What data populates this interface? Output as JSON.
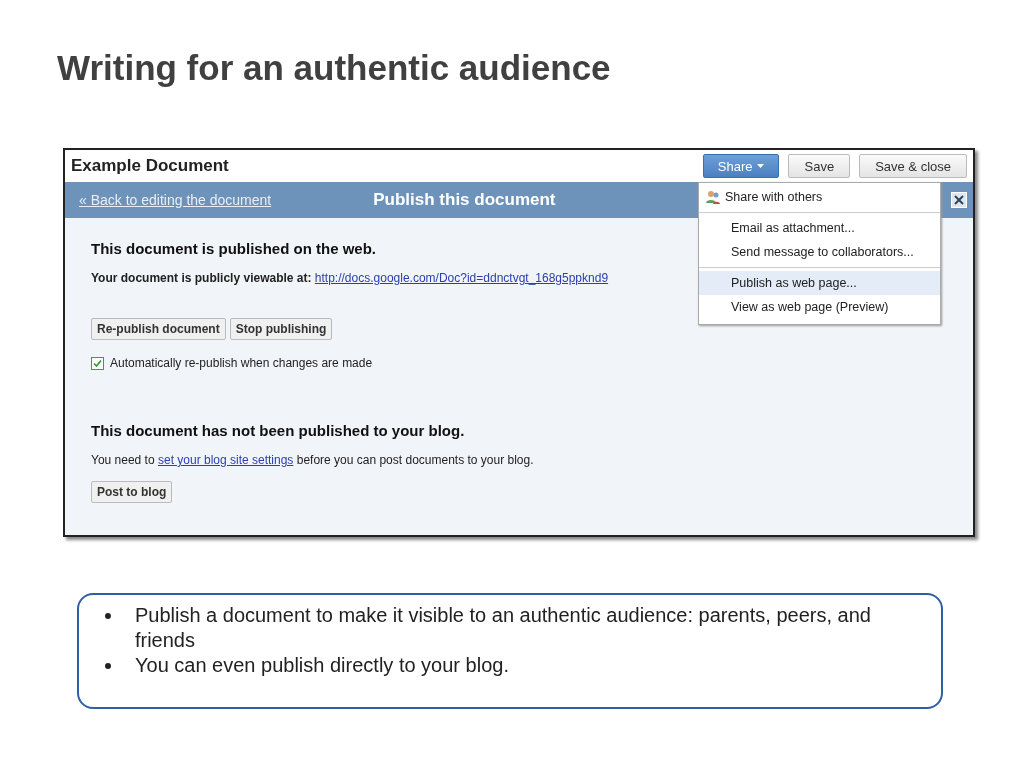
{
  "slide_title": "Writing for an authentic audience",
  "window": {
    "title": "Example Document",
    "buttons": [
      {
        "label": "Share",
        "kind": "menu"
      },
      {
        "label": "Save",
        "kind": "plain"
      },
      {
        "label": "Save & close",
        "kind": "plain"
      }
    ]
  },
  "publish_bar": {
    "back_link": "« Back to editing the document",
    "title": "Publish this document"
  },
  "share_menu": {
    "groups": [
      [
        {
          "label": "Share with others",
          "kind": "icon",
          "selected": false
        }
      ],
      [
        {
          "label": "Email as attachment...",
          "kind": "plain",
          "selected": false
        },
        {
          "label": "Send message to collaborators...",
          "kind": "plain",
          "selected": false
        }
      ],
      [
        {
          "label": "Publish as web page...",
          "kind": "plain",
          "selected": true
        },
        {
          "label": "View as web page (Preview)",
          "kind": "plain",
          "selected": false
        }
      ]
    ]
  },
  "web_section": {
    "heading": "This document is published on the web.",
    "url_label": "Your document is publicly viewable at:",
    "url": "http://docs.google.com/Doc?id=ddnctvgt_168g5ppknd9",
    "buttons": [
      "Re-publish document",
      "Stop publishing"
    ],
    "auto_republish": {
      "label": "Automatically re-publish when changes are made",
      "checked": true
    }
  },
  "blog_section": {
    "heading": "This document has not been published to your blog.",
    "text_before": "You need to",
    "link": "set your blog site settings",
    "text_after": "before you can post documents to your blog.",
    "button": "Post to blog"
  },
  "bullets": [
    "Publish a document to make it visible to an authentic audience: parents, peers, and friends",
    "You can even publish directly to your blog."
  ]
}
